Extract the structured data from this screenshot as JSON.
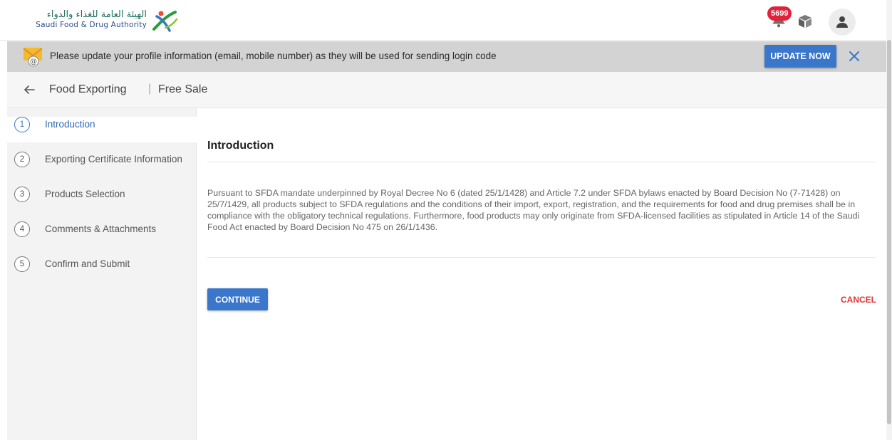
{
  "header": {
    "logo_arabic": "الهيئة العامة للغذاء والدواء",
    "logo_english": "Saudi Food & Drug Authority",
    "notification_count": "5699",
    "icons": [
      "bell-icon",
      "box-icon",
      "user-icon"
    ]
  },
  "banner": {
    "message": "Please update your profile information (email, mobile number) as they will be used for sending login code",
    "update_label": "UPDATE NOW",
    "icons": [
      "mail-icon",
      "close-icon"
    ]
  },
  "titlebar": {
    "title": "Food Exporting",
    "separator": "|",
    "subtitle": "Free Sale"
  },
  "steps": [
    {
      "num": "1",
      "label": "Introduction",
      "active": true
    },
    {
      "num": "2",
      "label": "Exporting Certificate Information",
      "active": false
    },
    {
      "num": "3",
      "label": "Products Selection",
      "active": false
    },
    {
      "num": "4",
      "label": "Comments & Attachments",
      "active": false
    },
    {
      "num": "5",
      "label": "Confirm and Submit",
      "active": false
    }
  ],
  "main": {
    "heading": "Introduction",
    "text": "Pursuant to SFDA mandate underpinned by Royal Decree No 6 (dated 25/1/1428) and Article 7.2 under SFDA bylaws enacted by Board Decision No (7-71428) on 25/7/1429, all products subject to SFDA regulations and the conditions of their import, export, registration, and the requirements for food and drug premises shall be in compliance with the obligatory technical regulations. Furthermore, food products may only originate from SFDA-licensed facilities as stipulated in Article 14 of the Saudi Food Act enacted by Board Decision No 475 on 26/1/1436.",
    "continue_label": "CONTINUE",
    "cancel_label": "CANCEL"
  },
  "colors": {
    "primary": "#3a76c9",
    "cancel": "#e03434",
    "badge": "#e0223a",
    "banner_bg": "#d3d3d3"
  }
}
